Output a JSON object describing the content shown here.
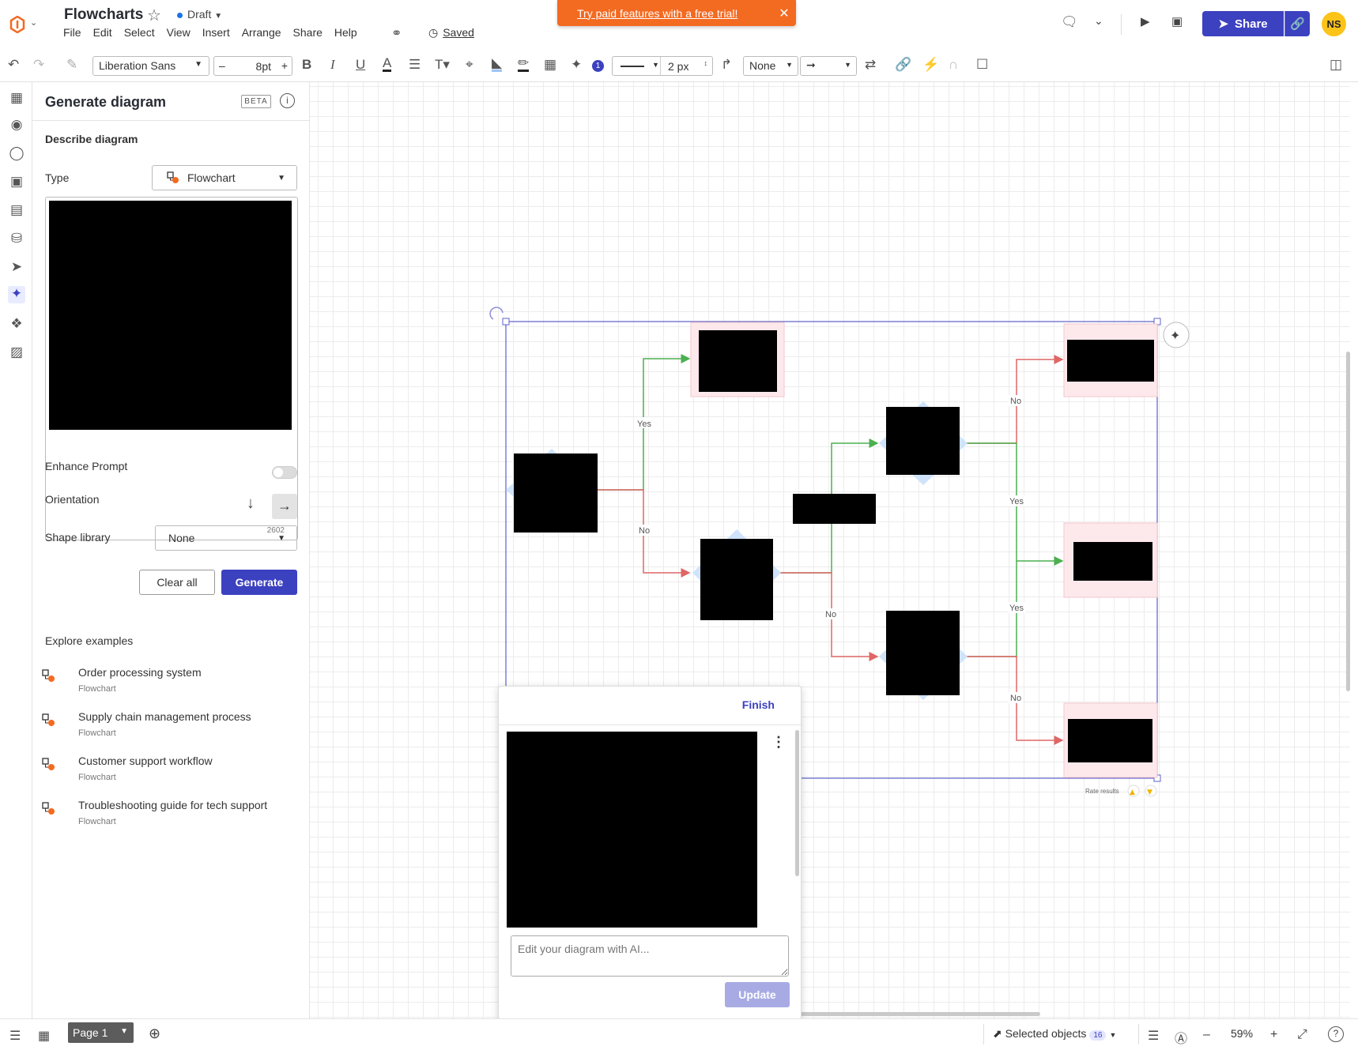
{
  "header": {
    "title": "Flowcharts",
    "status": "Draft",
    "saved": "Saved",
    "menu": [
      "File",
      "Edit",
      "Select",
      "View",
      "Insert",
      "Arrange",
      "Share",
      "Help"
    ],
    "trial_banner": "Try paid features with a free trial!",
    "share_label": "Share",
    "avatar_initials": "NS"
  },
  "toolbar": {
    "font": "Liberation Sans",
    "font_size": "8pt",
    "line_width": "2 px",
    "arrow_start": "None",
    "badge_count": "1"
  },
  "panel": {
    "title": "Generate diagram",
    "beta": "BETA",
    "section": "Describe diagram",
    "type_label": "Type",
    "type_value": "Flowchart",
    "char_count": "2602",
    "enhance_label": "Enhance Prompt",
    "orientation_label": "Orientation",
    "shape_library_label": "Shape library",
    "shape_library_value": "None",
    "clear_label": "Clear all",
    "generate_label": "Generate",
    "explore_label": "Explore examples",
    "examples": [
      {
        "title": "Order processing system",
        "type": "Flowchart"
      },
      {
        "title": "Supply chain management process",
        "type": "Flowchart"
      },
      {
        "title": "Customer support workflow",
        "type": "Flowchart"
      },
      {
        "title": "Troubleshooting guide for tech support",
        "type": "Flowchart"
      }
    ]
  },
  "diagram": {
    "labels": {
      "yes": "Yes",
      "no": "No"
    },
    "rate_results": "Rate results",
    "colors": {
      "yes_line": "#4caf50",
      "no_line": "#e06666",
      "selection": "#5c60c8",
      "end_fill": "#fde9ec"
    }
  },
  "ai_panel": {
    "finish": "Finish",
    "placeholder": "Edit your diagram with AI...",
    "update": "Update"
  },
  "statusbar": {
    "page": "Page 1",
    "selected_label": "Selected objects",
    "selected_count": "16",
    "zoom": "59%"
  },
  "colors": {
    "accent": "#3c41c0",
    "banner": "#f36a21",
    "avatar": "#fcc419"
  }
}
